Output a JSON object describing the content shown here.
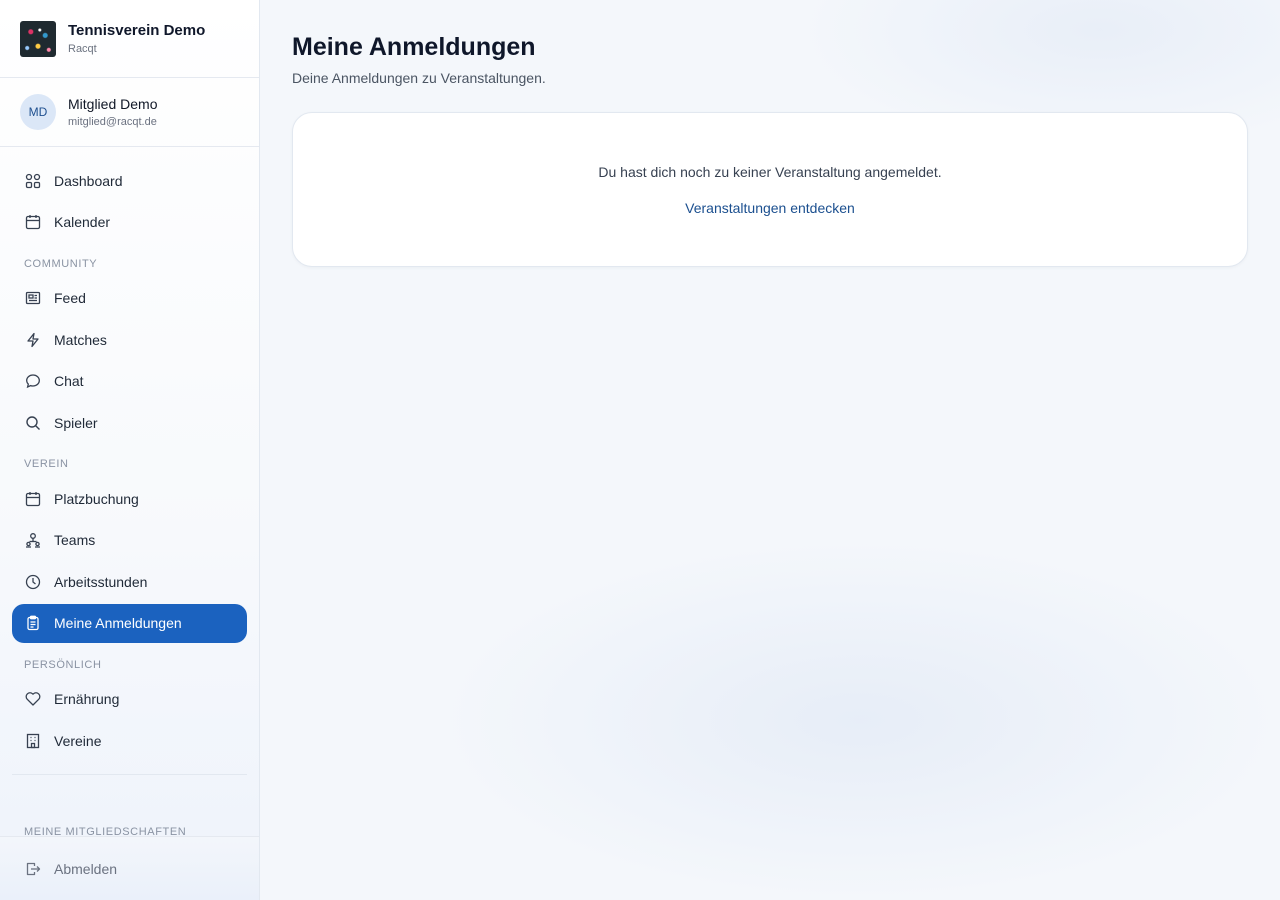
{
  "brand": {
    "title": "Tennisverein Demo",
    "subtitle": "Racqt"
  },
  "user": {
    "initials": "MD",
    "name": "Mitglied Demo",
    "email": "mitglied@racqt.de"
  },
  "nav": {
    "dashboard": "Dashboard",
    "kalender": "Kalender",
    "community_label": "COMMUNITY",
    "feed": "Feed",
    "matches": "Matches",
    "chat": "Chat",
    "spieler": "Spieler",
    "verein_label": "VEREIN",
    "platzbuchung": "Platzbuchung",
    "teams": "Teams",
    "arbeitsstunden": "Arbeitsstunden",
    "meine_anmeldungen": "Meine Anmeldungen",
    "persoenlich_label": "PERSÖNLICH",
    "ernaehrung": "Ernährung",
    "vereine": "Vereine",
    "mitgliedschaften_label": "MEINE MITGLIEDSCHAFTEN",
    "abmelden": "Abmelden"
  },
  "page": {
    "title": "Meine Anmeldungen",
    "subtitle": "Deine Anmeldungen zu Veranstaltungen.",
    "empty_text": "Du hast dich noch zu keiner Veranstaltung angemeldet.",
    "discover_link": "Veranstaltungen entdecken"
  },
  "colors": {
    "accent": "#1b62bf",
    "link": "#1b4f8f"
  }
}
